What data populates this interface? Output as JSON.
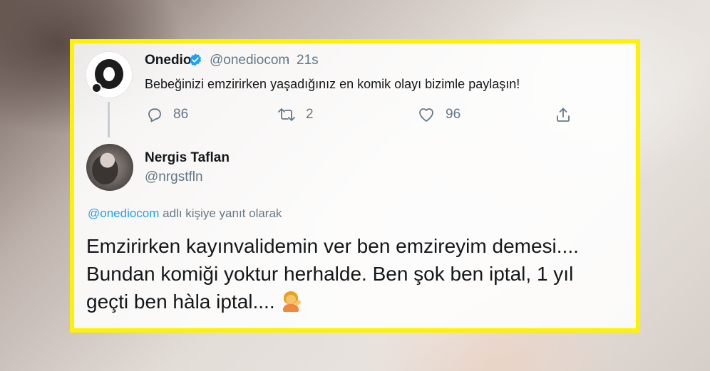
{
  "tweet": {
    "author_name": "Onedio",
    "author_handle": "@onediocom",
    "separator": "·",
    "time": "21s",
    "text": "Bebeğinizi emzirirken yaşadığınız en komik olayı bizimle paylaşın!",
    "actions": {
      "replies": "86",
      "retweets": "2",
      "likes": "96"
    }
  },
  "reply": {
    "author_name": "Nergis Taflan",
    "author_handle": "@nrgstfln",
    "reply_to_mention": "@onediocom",
    "reply_to_suffix": "adlı kişiye yanıt olarak",
    "text_line1": "Emzirirken kayınvalidemin ver ben emzireyim demesi....",
    "text_line2": "Bundan komiği yoktur herhalde. Ben şok ben iptal, 1 yıl",
    "text_line3": "geçti ben hàla iptal...."
  },
  "colors": {
    "highlight_border": "#fff200",
    "link_blue": "#1da1f2",
    "muted_gray": "#657786",
    "text_dark": "#14171a"
  },
  "icons": {
    "verified": "verified-badge-icon",
    "reply": "reply-icon",
    "retweet": "retweet-icon",
    "like": "heart-icon",
    "share": "share-icon",
    "emoji": "person-tipping-hand-emoji-icon"
  }
}
